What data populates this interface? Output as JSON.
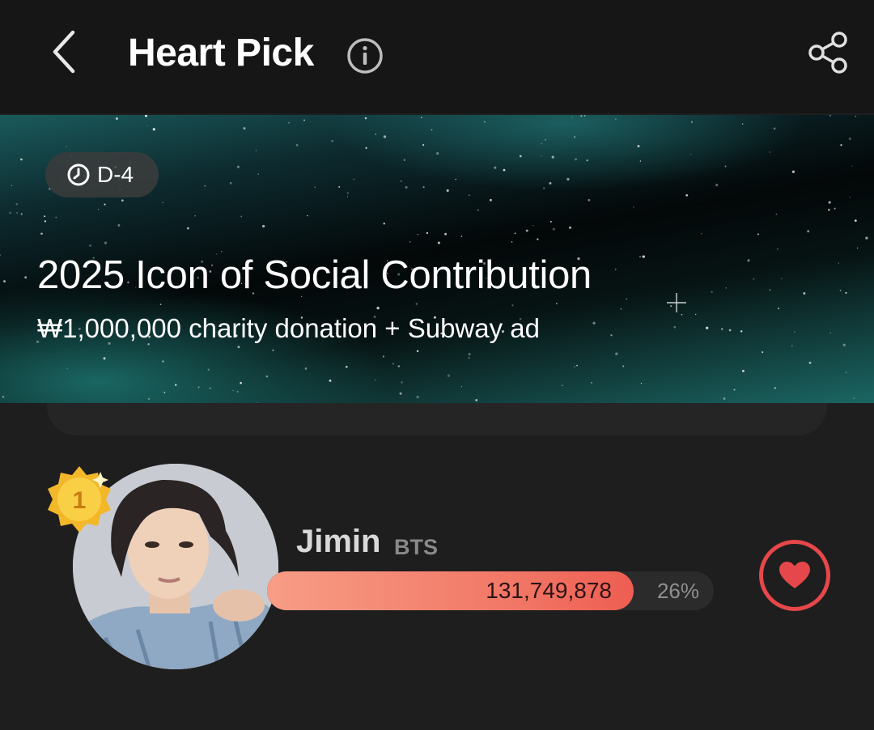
{
  "header": {
    "title": "Heart Pick",
    "back_icon": "chevron-left-icon",
    "info_icon": "info-icon",
    "share_icon": "share-icon"
  },
  "banner": {
    "dday_icon": "clock-icon",
    "dday": "D-4",
    "title": "2025 Icon of Social Contribution",
    "subtitle": "₩1,000,000 charity donation + Subway ad"
  },
  "ranking": [
    {
      "rank": "1",
      "name": "Jimin",
      "group": "BTS",
      "votes": "131,749,878",
      "percent": "26%",
      "bar_fraction": 0.82,
      "vote_icon": "heart-icon"
    }
  ],
  "colors": {
    "accent": "#e6474a",
    "bar_start": "#f79d86",
    "bar_end": "#ee5d52",
    "medal": "#f5c33b"
  }
}
